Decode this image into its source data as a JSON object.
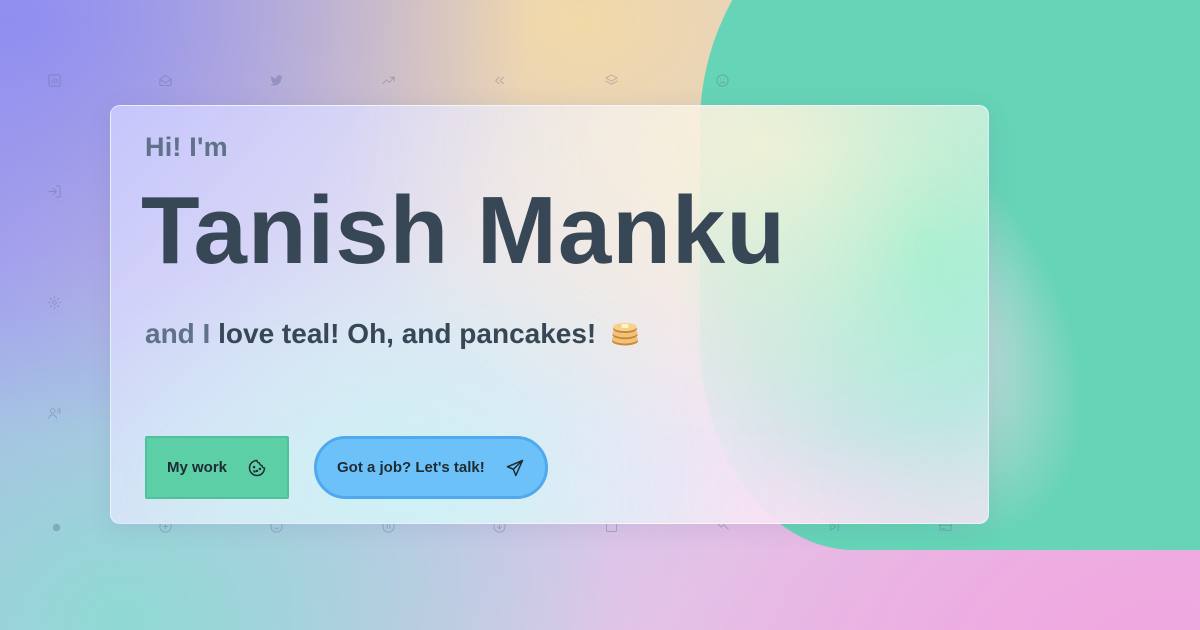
{
  "hero": {
    "greeting": "Hi! I'm",
    "name": "Tanish Manku",
    "tagline_soft": "and I",
    "tagline_main": "love teal! Oh, and pancakes!",
    "tagline_emoji_icon": "pancakes-icon"
  },
  "buttons": {
    "work_label": "My work",
    "work_icon": "cookie-icon",
    "talk_label": "Got a job? Let's talk!",
    "talk_icon": "paper-plane-icon"
  },
  "colors": {
    "teal_accent": "#66d4b6",
    "heading_text": "#374756",
    "muted_text": "#5f7289",
    "work_button": "#5ccfa6",
    "talk_button": "#6cc2f8"
  },
  "background_icons": [
    "bar-chart-icon",
    "mail-open-icon",
    "twitter-icon",
    "trending-up-icon",
    "chevrons-left-icon",
    "layers-icon",
    "sad-face-icon",
    "log-in-icon",
    "settings-icon",
    "user-voice-icon",
    "dot-icon",
    "plus-circle-icon",
    "smile-icon",
    "pause-circle-icon",
    "download-circle-icon",
    "square-icon",
    "shuffle-icon",
    "skip-forward-icon",
    "credit-card-icon"
  ]
}
